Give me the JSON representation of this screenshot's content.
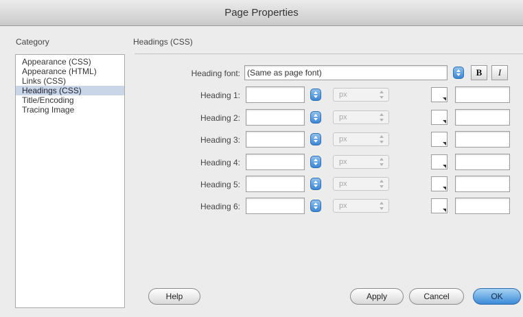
{
  "window": {
    "title": "Page Properties"
  },
  "sidebar": {
    "label": "Category",
    "items": [
      {
        "label": "Appearance (CSS)",
        "selected": false
      },
      {
        "label": "Appearance (HTML)",
        "selected": false
      },
      {
        "label": "Links (CSS)",
        "selected": false
      },
      {
        "label": "Headings (CSS)",
        "selected": true
      },
      {
        "label": "Title/Encoding",
        "selected": false
      },
      {
        "label": "Tracing Image",
        "selected": false
      }
    ]
  },
  "main": {
    "section_title": "Headings (CSS)",
    "heading_font": {
      "label": "Heading font:",
      "value": "(Same as page font)"
    },
    "bold_label": "B",
    "italic_label": "I",
    "headings": [
      {
        "label": "Heading 1:",
        "size": "",
        "unit": "px",
        "color": ""
      },
      {
        "label": "Heading 2:",
        "size": "",
        "unit": "px",
        "color": ""
      },
      {
        "label": "Heading 3:",
        "size": "",
        "unit": "px",
        "color": ""
      },
      {
        "label": "Heading 4:",
        "size": "",
        "unit": "px",
        "color": ""
      },
      {
        "label": "Heading 5:",
        "size": "",
        "unit": "px",
        "color": ""
      },
      {
        "label": "Heading 6:",
        "size": "",
        "unit": "px",
        "color": ""
      }
    ]
  },
  "buttons": {
    "help": "Help",
    "apply": "Apply",
    "cancel": "Cancel",
    "ok": "OK"
  },
  "colors": {
    "accent": "#3d86d2",
    "selection": "#c9d6e8"
  }
}
